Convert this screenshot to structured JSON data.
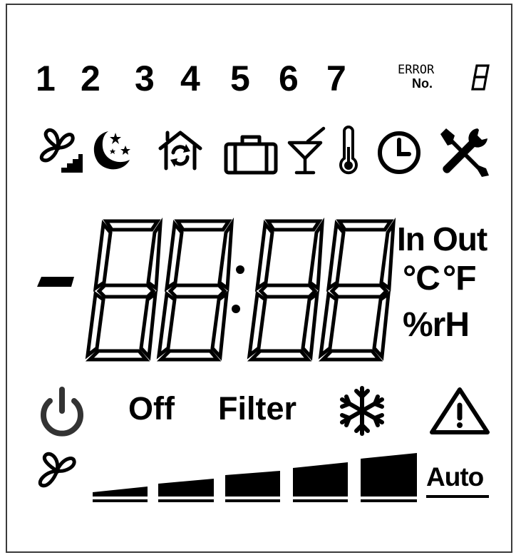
{
  "program_numbers": [
    "1",
    "2",
    "3",
    "4",
    "5",
    "6",
    "7"
  ],
  "error": {
    "label": "ERROR",
    "number_label": "No."
  },
  "mode_icons": [
    "fan-step-icon",
    "night-moon-stars-icon",
    "home-cycle-icon",
    "suitcase-icon",
    "cocktail-glass-icon",
    "thermometer-icon",
    "clock-icon",
    "tools-icon"
  ],
  "units": {
    "in": "In",
    "out": "Out",
    "celsius": "°C",
    "fahrenheit": "°F",
    "humidity": "%rH"
  },
  "status": {
    "off": "Off",
    "filter": "Filter"
  },
  "status_icons": [
    "power-icon",
    "snowflake-icon",
    "warning-icon"
  ],
  "fan_speed": {
    "levels": 5,
    "auto_label": "Auto"
  },
  "colors": {
    "segment": "#000000",
    "frame": "#3a3a3a",
    "power": "#333333"
  }
}
